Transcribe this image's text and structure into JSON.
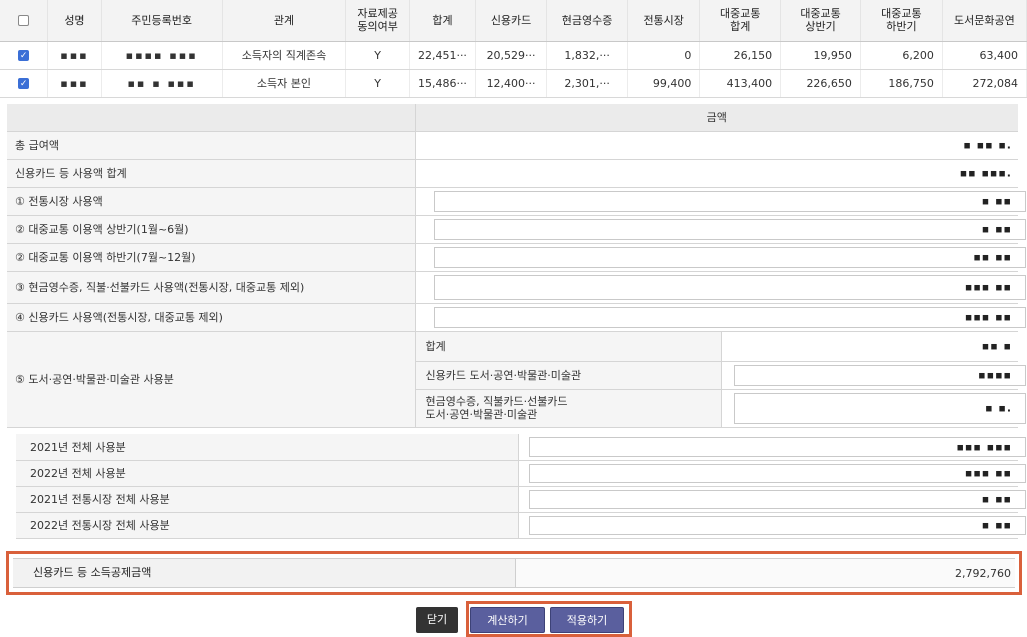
{
  "dependents": {
    "headers": [
      "성명",
      "주민등록번호",
      "관계",
      "자료제공\n동의여부",
      "합계",
      "신용카드",
      "현금영수증",
      "전통시장",
      "대중교통\n합계",
      "대중교통\n상반기",
      "대중교통\n하반기",
      "도서문화공연"
    ],
    "rows": [
      {
        "name": "▪︎▪︎▪︎",
        "rrn": "▪︎▪︎▪︎▪︎ ▪︎▪︎▪︎",
        "relation": "소득자의 직계존속",
        "consent": "Y",
        "total": "22,451···",
        "card": "20,529···",
        "cash": "1,832,···",
        "market": "0",
        "transit_total": "26,150",
        "transit_h1": "19,950",
        "transit_h2": "6,200",
        "culture": "63,400"
      },
      {
        "name": "▪︎▪︎▪︎",
        "rrn": "▪︎▪︎ ▪︎ ▪︎▪︎▪︎",
        "relation": "소득자 본인",
        "consent": "Y",
        "total": "15,486···",
        "card": "12,400···",
        "cash": "2,301,···",
        "market": "99,400",
        "transit_total": "413,400",
        "transit_h1": "226,650",
        "transit_h2": "186,750",
        "culture": "272,084"
      }
    ]
  },
  "deduction": {
    "amount_header": "금액",
    "total_salary_label": "총 급여액",
    "total_salary_value": "▪︎ ▪︎▪︎ ▪︎.",
    "card_total_label": "신용카드 등 사용액 합계",
    "card_total_value": "▪︎▪︎ ▪︎▪︎▪︎.",
    "market_label": "① 전통시장 사용액",
    "market_value": "▪︎ ▪︎▪︎",
    "transit_h1_label": "② 대중교통 이용액 상반기(1월~6월)",
    "transit_h1_value": "▪︎ ▪︎▪︎",
    "transit_h2_label": "② 대중교통 이용액 하반기(7월~12월)",
    "transit_h2_value": "▪︎▪︎ ▪︎▪︎",
    "cash_label": "③ 현금영수증, 직불·선불카드 사용액(전통시장, 대중교통 제외)",
    "cash_value": "▪︎▪︎▪︎ ▪︎▪︎",
    "card_label": "④ 신용카드 사용액(전통시장, 대중교통 제외)",
    "card_value": "▪︎▪︎▪︎ ▪︎▪︎",
    "culture_label": "⑤ 도서·공연·박물관·미술관 사용분",
    "culture_sum_label": "합계",
    "culture_sum_value": "▪︎▪︎ ▪︎",
    "culture_card_label": "신용카드 도서·공연·박물관·미술관",
    "culture_card_value": "▪︎▪︎▪︎▪︎",
    "culture_cash_label": "현금영수증, 직불카드·선불카드\n도서·공연·박물관·미술관",
    "culture_cash_value": "▪︎ ▪︎."
  },
  "yearly": [
    {
      "label": "2021년 전체 사용분",
      "value": "▪︎▪︎▪︎ ▪︎▪︎▪︎"
    },
    {
      "label": "2022년 전체 사용분",
      "value": "▪︎▪︎▪︎ ▪︎▪︎"
    },
    {
      "label": "2021년 전통시장 전체 사용분",
      "value": "▪︎ ▪︎▪︎"
    },
    {
      "label": "2022년 전통시장 전체 사용분",
      "value": "▪︎ ▪︎▪︎"
    }
  ],
  "result": {
    "label": "신용카드 등 소득공제금액",
    "value": "2,792,760"
  },
  "buttons": {
    "close": "닫기",
    "calculate": "계산하기",
    "apply": "적용하기"
  },
  "colors": {
    "highlight": "#d9603b",
    "button_primary": "#5a5f9e",
    "button_dark": "#333333",
    "checkbox": "#3b6fd6"
  }
}
